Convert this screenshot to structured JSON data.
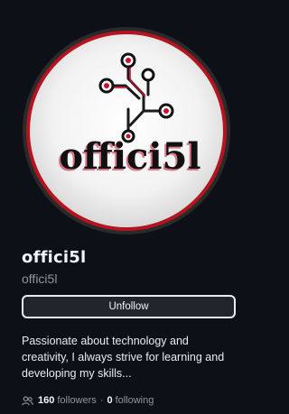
{
  "profile": {
    "avatar_text": "offici5l",
    "display_name": "offici5l",
    "username": "offici5l",
    "unfollow_label": "Unfollow",
    "bio": "Passionate about technology and creativity, I always strive for learning and developing my skills...",
    "followers_count": "160",
    "followers_label": "followers",
    "separator": "·",
    "following_count": "0",
    "following_label": "following"
  },
  "colors": {
    "background": "#0d1117",
    "text_primary": "#f0f6fc",
    "text_muted": "#8d96a0",
    "button_bg": "#21262d",
    "button_border": "#e6edf3",
    "avatar_accent_red": "#c8102e"
  },
  "icons": {
    "people": "people-icon"
  }
}
